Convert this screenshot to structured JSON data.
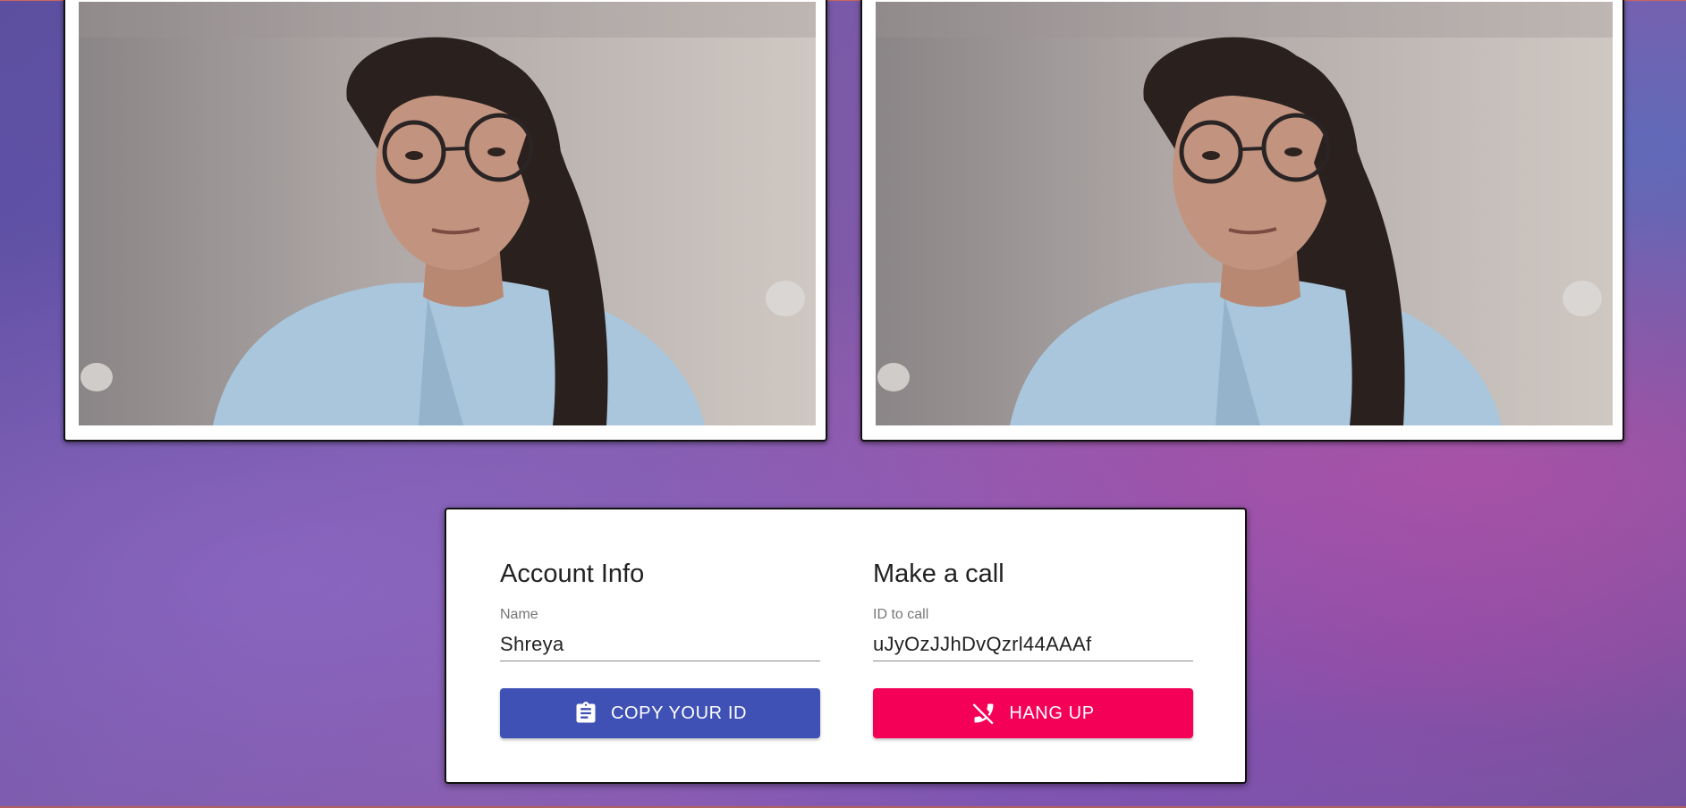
{
  "account": {
    "title": "Account Info",
    "name_label": "Name",
    "name_value": "Shreya",
    "copy_button_label": "COPY YOUR ID",
    "copy_button_icon": "clipboard-icon"
  },
  "call": {
    "title": "Make a call",
    "id_label": "ID to call",
    "id_value": "uJyOzJJhDvQzrl44AAAf",
    "hangup_button_label": "HANG UP",
    "hangup_button_icon": "phone-disabled-icon"
  },
  "colors": {
    "primary": "#3f51b5",
    "danger": "#f50057"
  }
}
